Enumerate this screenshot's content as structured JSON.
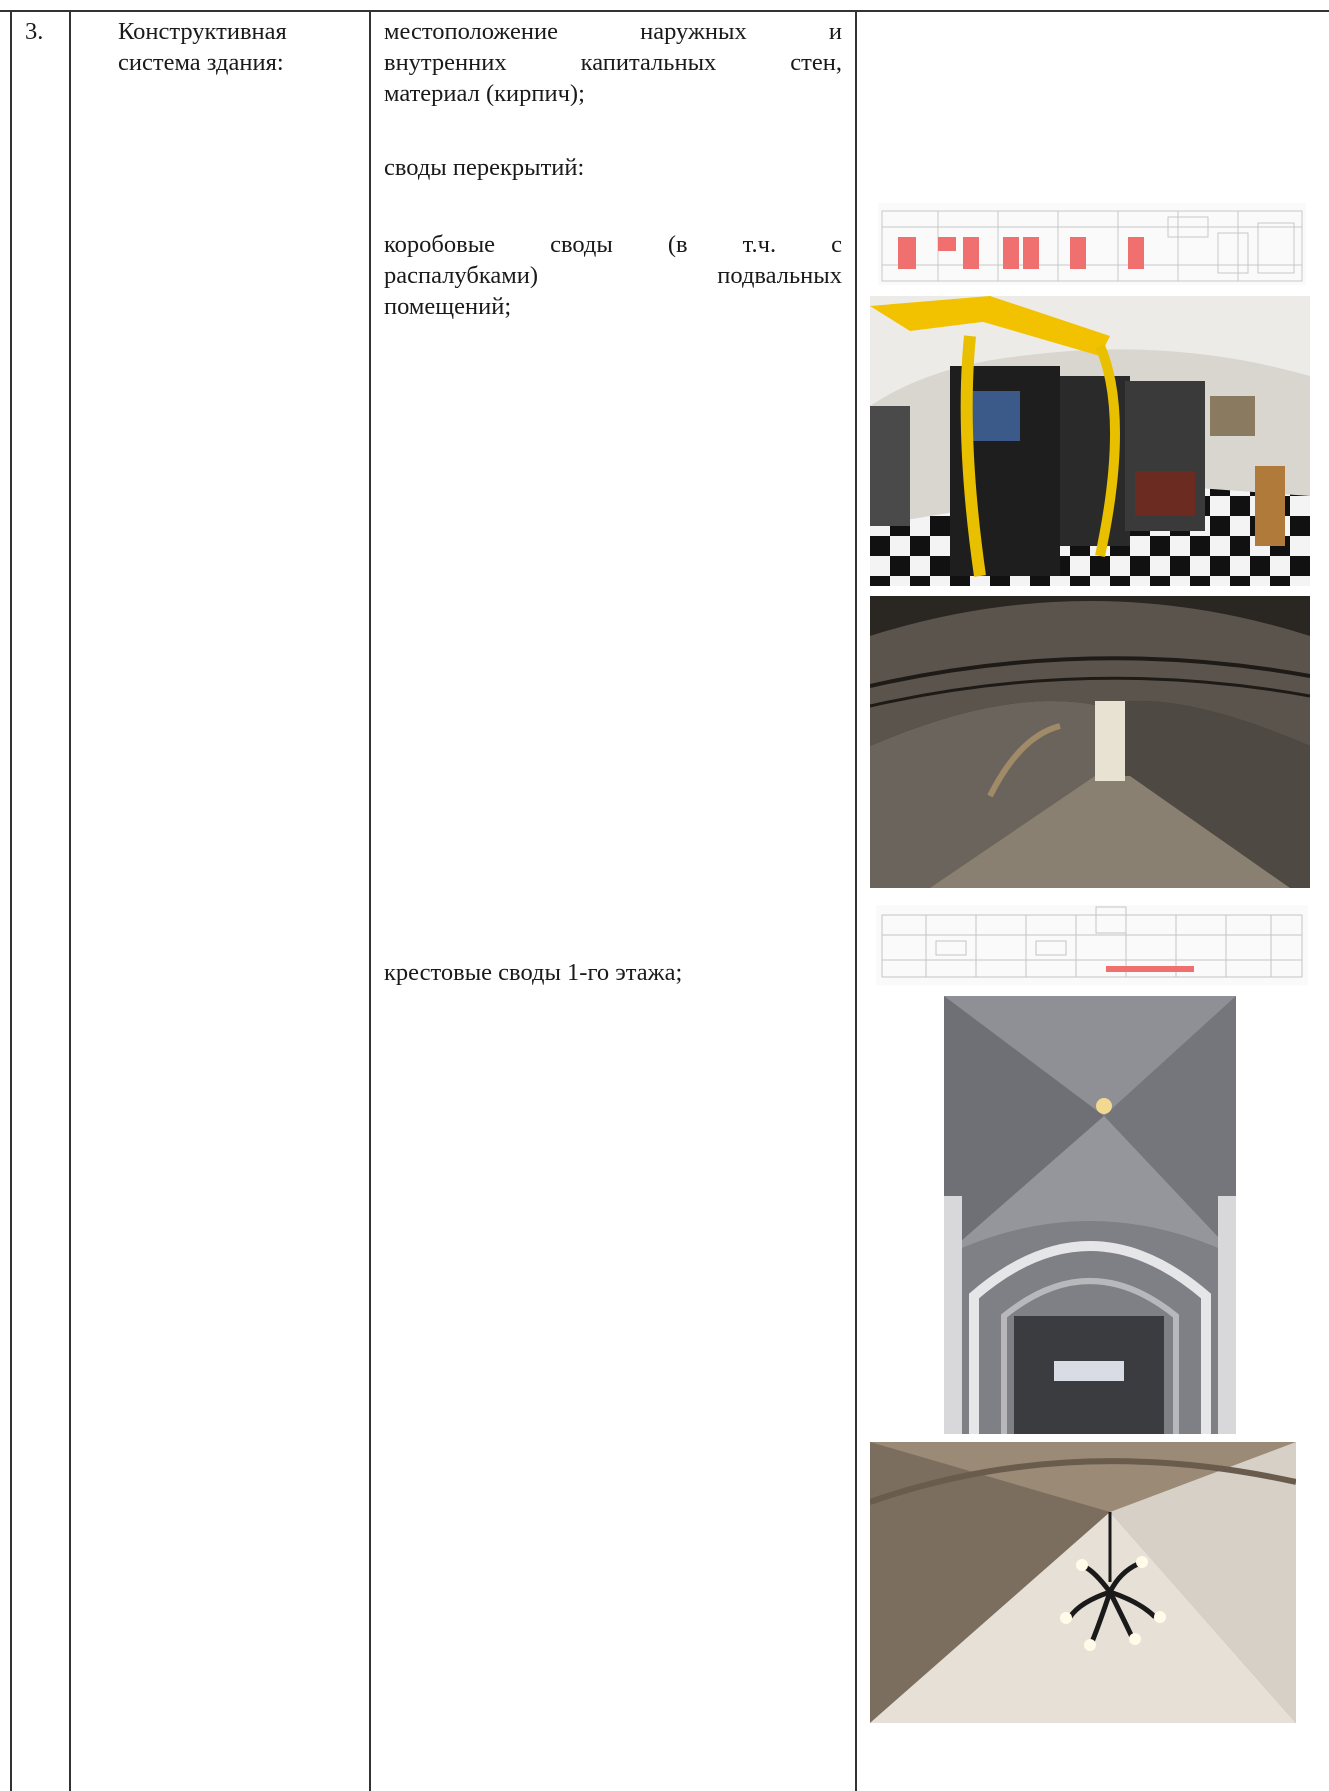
{
  "row": {
    "number": "3.",
    "label_line1": "Конструктивная",
    "label_line2": "система здания:"
  },
  "description": {
    "walls_line1": "местоположение наружных и",
    "walls_line2": "внутренних капитальных стен,",
    "walls_line3": "материал (кирпич);",
    "vaults_heading": "своды перекрытий:",
    "box_vaults_line1": "коробовые своды (в т.ч. с",
    "box_vaults_line2": "распалубками) подвальных",
    "box_vaults_line3": "помещений;",
    "cross_vaults": "крестовые своды 1-го этажа;"
  },
  "images": [
    {
      "name": "basement-plan-image",
      "type": "floor plan with red highlighted areas"
    },
    {
      "name": "basement-exhibition-photo",
      "type": "photo"
    },
    {
      "name": "basement-corridor-photo",
      "type": "photo"
    },
    {
      "name": "first-floor-plan-image",
      "type": "floor plan with red highlighted strip"
    },
    {
      "name": "cross-vault-corridor-photo",
      "type": "photo"
    },
    {
      "name": "cross-vault-chandelier-photo",
      "type": "photo"
    }
  ],
  "colors": {
    "highlight": "#f07070",
    "border": "#333333"
  }
}
